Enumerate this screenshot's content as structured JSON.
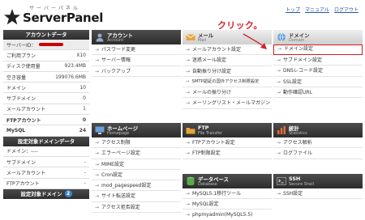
{
  "logo": {
    "ruby": "サーバーパネル",
    "name": "ServerPanel"
  },
  "toplinks": [
    "トップ",
    "マニュアル",
    "ログアウト"
  ],
  "account": {
    "header": "アカウントデータ",
    "server_id_label": "サーバーID：",
    "rows": [
      {
        "label": "ご利用プラン",
        "value": "X10"
      },
      {
        "label": "ディスク使用量",
        "value": "923.4MB"
      },
      {
        "label": "空き容量",
        "value": "199076.6MB"
      },
      {
        "label": "ドメイン",
        "value": "10"
      },
      {
        "label": "サブドメイン",
        "value": "0"
      },
      {
        "label": "メールアカウント",
        "value": "1"
      },
      {
        "label": "FTPアカウント",
        "value": "0"
      },
      {
        "label": "MySQL",
        "value": "24"
      }
    ]
  },
  "domain_data": {
    "header": "設定対象ドメインデータ",
    "domain_label": "ドメイン：----",
    "rows": [
      {
        "label": "サブドメイン",
        "value": "-"
      },
      {
        "label": "メールアカウント",
        "value": "-"
      },
      {
        "label": "FTPアカウント",
        "value": "-"
      }
    ]
  },
  "target_domain": {
    "header": "設定対象ドメイン",
    "badge": "2"
  },
  "callout": "クリック。",
  "sections": [
    {
      "title": "アカウント",
      "sub": "Account",
      "icon": "person-icon",
      "items": [
        "パスワード変更",
        "サーバー情報",
        "バックアップ"
      ]
    },
    {
      "title": "メール",
      "sub": "Mail",
      "icon": "mail-icon",
      "items": [
        "メールアカウント設定",
        "迷惑メール設定",
        "自動振り分け設定",
        "SMTP認証の国外アクセス制限設定",
        "メールの振り分け",
        "メーリングリスト・メールマガジン"
      ]
    },
    {
      "title": "ドメイン",
      "sub": "Domain",
      "icon": "globe-icon",
      "items": [
        "ドメイン設定",
        "サブドメイン設定",
        "DNSレコード設定",
        "SSL設定",
        "動作確認URL"
      ]
    },
    {
      "title": "ホームページ",
      "sub": "Homepage",
      "icon": "monitor-icon",
      "items": [
        "アクセス制限",
        "エラーページ設定",
        "MIME設定",
        "Cron設定",
        "mod_pagespeed設定",
        "サイト転送設定",
        "アクセス拒否設定"
      ]
    },
    {
      "title": "FTP",
      "sub": "File Transfer",
      "icon": "folder-icon",
      "items": [
        "FTPアカウント設定",
        "FTP制限設定"
      ]
    },
    {
      "title": "統計",
      "sub": "Statistics",
      "icon": "chart-icon",
      "items": [
        "アクセス解析",
        "ログファイル"
      ]
    },
    {
      "title": "データベース",
      "sub": "Database",
      "icon": "database-icon",
      "items": [
        "MySQL5.1移行ツール",
        "MySQL設定",
        "phpmyadmin(MySQL5.5)"
      ]
    },
    {
      "title": "SSH",
      "sub": "Secure Shell",
      "icon": "ssh-icon",
      "items": [
        "SSH設定"
      ]
    }
  ]
}
